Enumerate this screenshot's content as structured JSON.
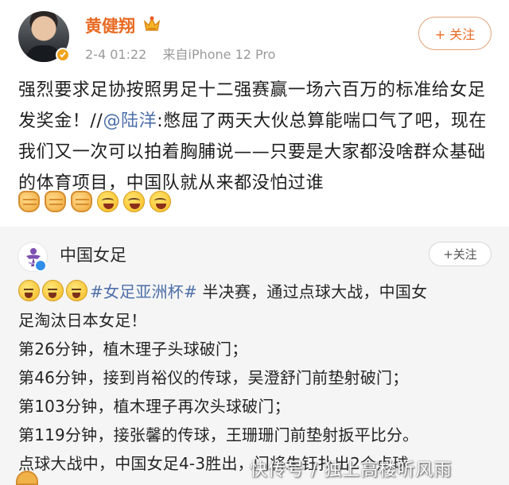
{
  "author": {
    "name": "黄健翔",
    "time": "2-4 01:22",
    "source": "来自iPhone 12 Pro",
    "follow": "+ 关注"
  },
  "post": {
    "text_before": "强烈要求足协按照男足十二强赛赢一场六百万的标准给女足发奖金！//",
    "mention": "@陆洋",
    "text_after": ":憋屈了两天大伙总算能喘口气了吧，现在我们又一次可以拍着胸脯说——只要是大家都没啥群众基础的体育项目，中国队就从来都没怕过谁"
  },
  "repost": {
    "name": "中国女足",
    "follow": "+关注",
    "hashtag": "#女足亚洲杯#",
    "lead_text": " 半决赛，通过点球大战，中国女",
    "lines": [
      "足淘汰日本女足！",
      "第26分钟，植木理子头球破门；",
      "第46分钟，接到肖裕仪的传球，吴澄舒门前垫射破门；",
      "第103分钟，植木理子再次头球破门；",
      "第119分钟，接张馨的传球，王珊珊门前垫射扳平比分。",
      "点球大战中，中国女足4-3胜出，门将朱钰扑出2个点球"
    ]
  },
  "watermark": "快传号 / 独上高楼听风雨",
  "colors": {
    "accent": "#e86b24",
    "link": "#4d6fa9",
    "meta": "#9a9a9a",
    "card_bg": "#f5f5f5"
  },
  "icons": [
    "crown-icon",
    "verified-badge-icon",
    "fist-icon",
    "laugh-icon",
    "cry-icon",
    "muscle-icon"
  ]
}
